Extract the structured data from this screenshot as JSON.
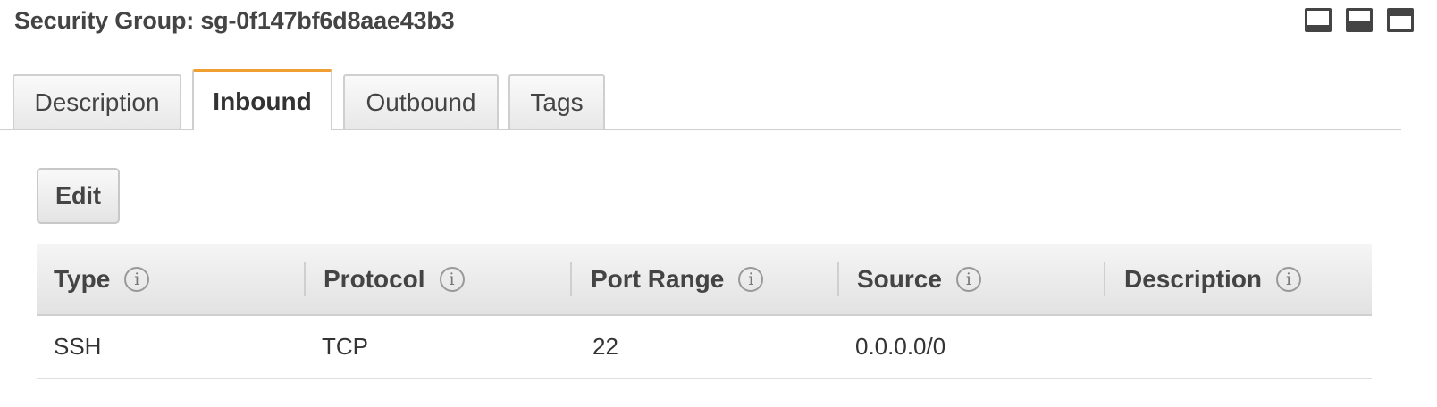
{
  "panel": {
    "title": "Security Group: sg-0f147bf6d8aae43b3"
  },
  "view_icons": [
    "panel-bottom-icon",
    "panel-split-icon",
    "panel-top-icon"
  ],
  "tabs": [
    {
      "label": "Description",
      "active": false
    },
    {
      "label": "Inbound",
      "active": true
    },
    {
      "label": "Outbound",
      "active": false
    },
    {
      "label": "Tags",
      "active": false
    }
  ],
  "toolbar": {
    "edit_label": "Edit"
  },
  "table": {
    "columns": [
      "Type",
      "Protocol",
      "Port Range",
      "Source",
      "Description"
    ],
    "rows": [
      {
        "type": "SSH",
        "protocol": "TCP",
        "port_range": "22",
        "source": "0.0.0.0/0",
        "description": ""
      }
    ]
  },
  "colors": {
    "active_tab_accent": "#f0a033",
    "border": "#cfcfcf",
    "text": "#444444"
  }
}
